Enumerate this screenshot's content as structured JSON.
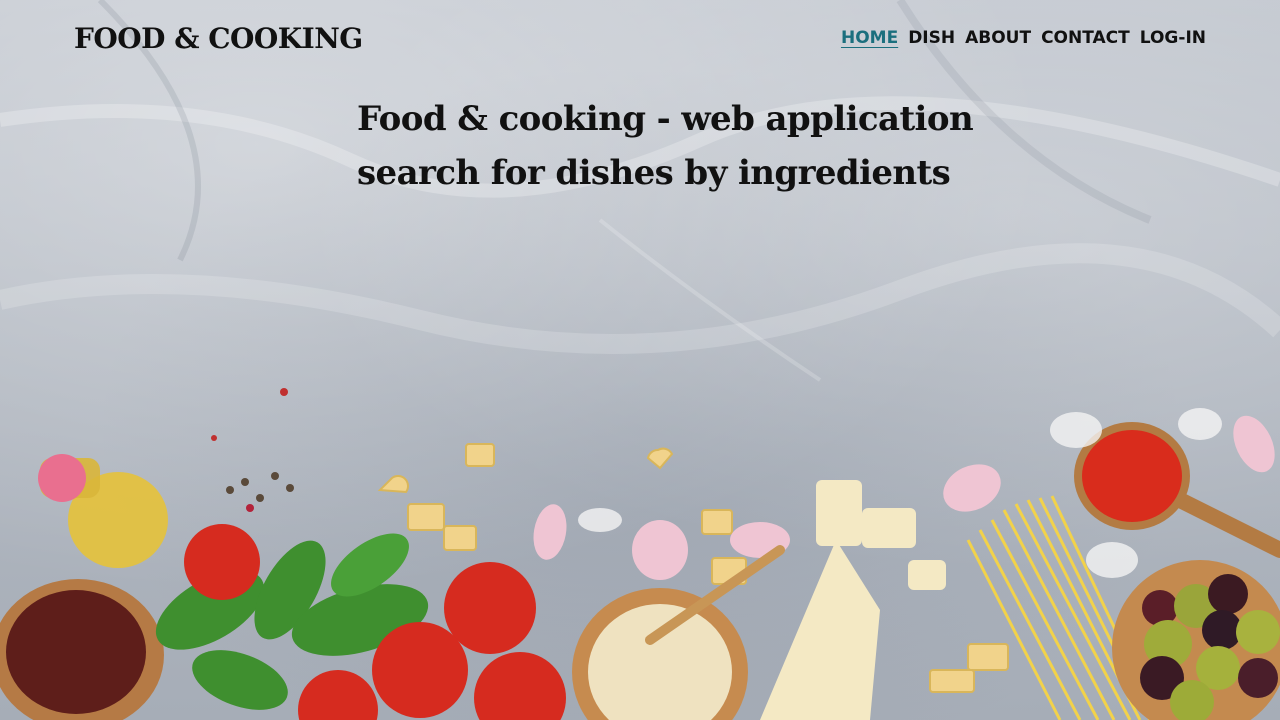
{
  "brand": {
    "logo_text": "FOOD & COOKING"
  },
  "nav": {
    "items": [
      {
        "label": "HOME",
        "active": true
      },
      {
        "label": "DISH",
        "active": false
      },
      {
        "label": "ABOUT",
        "active": false
      },
      {
        "label": "CONTACT",
        "active": false
      },
      {
        "label": "LOG-IN",
        "active": false
      }
    ]
  },
  "hero": {
    "line1": "Food & cooking - web application",
    "line2": "search for dishes by ingredients"
  },
  "colors": {
    "accent": "#1b6f7e",
    "text": "#111111"
  },
  "background_image": {
    "items": [
      "olive-oil-bottle-icon",
      "peppercorns-icon",
      "pasta-hearts-icon",
      "garlic-icon",
      "tomato-sauce-bowl-icon",
      "sun-dried-tomatoes-bowl-icon",
      "basil-icon",
      "cherry-tomatoes-icon",
      "pine-nuts-bowl-icon",
      "parmesan-icon",
      "spaghetti-icon",
      "olives-bowl-icon"
    ]
  }
}
